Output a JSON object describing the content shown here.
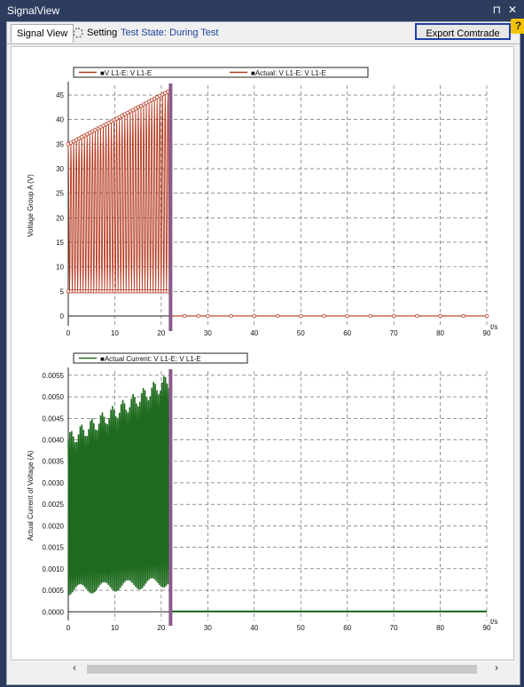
{
  "window": {
    "title": "SignalView",
    "pin_glyph": "⊓",
    "close_glyph": "✕"
  },
  "tabs": [
    {
      "label": "Signal View"
    },
    {
      "label": "Setting"
    }
  ],
  "test_state": "Test State: During Test",
  "export_button": "Export Comtrade ...",
  "help_badge": "?",
  "colors": {
    "voltage": "#b5391f",
    "current": "#1e6b1e",
    "cursor": "#8a5a8a"
  },
  "scroll": {
    "left": "‹",
    "right": "›"
  },
  "charts": {
    "voltage": {
      "legend": [
        "V L1-E: V L1-E",
        "Actual: V L1-E: V L1-E"
      ],
      "ylabel": "Voltage Group A (V)",
      "xunit": "t/s",
      "yticks": [
        "0",
        "5",
        "10",
        "15",
        "20",
        "25",
        "30",
        "35",
        "40",
        "45"
      ],
      "xticks": [
        "0",
        "10",
        "20",
        "30",
        "40",
        "50",
        "60",
        "70",
        "80",
        "90"
      ]
    },
    "current": {
      "legend": [
        "Actual Current: V L1-E: V L1-E"
      ],
      "ylabel": "Actual Current of Voltage (A)",
      "xunit": "t/s",
      "yticks": [
        "0.0000",
        "0.0005",
        "0.0010",
        "0.0015",
        "0.0020",
        "0.0025",
        "0.0030",
        "0.0035",
        "0.0040",
        "0.0045",
        "0.0050",
        "0.0055"
      ],
      "xticks": [
        "0",
        "10",
        "20",
        "30",
        "40",
        "50",
        "60",
        "70",
        "80",
        "90"
      ]
    }
  },
  "chart_data": [
    {
      "type": "line",
      "ylabel": "Voltage Group A (V)",
      "xlabel": "t/s",
      "xlim": [
        0,
        90
      ],
      "ylim": [
        -2,
        47
      ],
      "grid": true,
      "legend_position": "top-left",
      "cursor_x": 22,
      "series": [
        {
          "name": "V L1-E: V L1-E",
          "envelope": {
            "x": [
              0,
              22
            ],
            "y_max": [
              35,
              46
            ],
            "y_min": [
              5,
              5
            ]
          },
          "after_cursor": 0
        },
        {
          "name": "Actual: V L1-E: V L1-E",
          "x": [
            22,
            25,
            28,
            30,
            35,
            40,
            45,
            50,
            55,
            60,
            65,
            70,
            75,
            80,
            85,
            90
          ],
          "y": [
            0,
            0,
            0,
            0,
            0,
            0,
            0,
            0,
            0,
            0,
            0,
            0,
            0,
            0,
            0,
            0
          ]
        }
      ]
    },
    {
      "type": "line",
      "ylabel": "Actual Current of Voltage (A)",
      "xlabel": "t/s",
      "xlim": [
        0,
        90
      ],
      "ylim": [
        -0.0002,
        0.0056
      ],
      "grid": true,
      "legend_position": "top-left",
      "cursor_x": 22,
      "series": [
        {
          "name": "Actual Current: V L1-E: V L1-E",
          "envelope": {
            "x": [
              0,
              22
            ],
            "y_max": [
              0.004,
              0.0054
            ],
            "y_min": [
              0.0005,
              0.0007
            ]
          },
          "after_cursor": 1e-05
        }
      ]
    }
  ]
}
